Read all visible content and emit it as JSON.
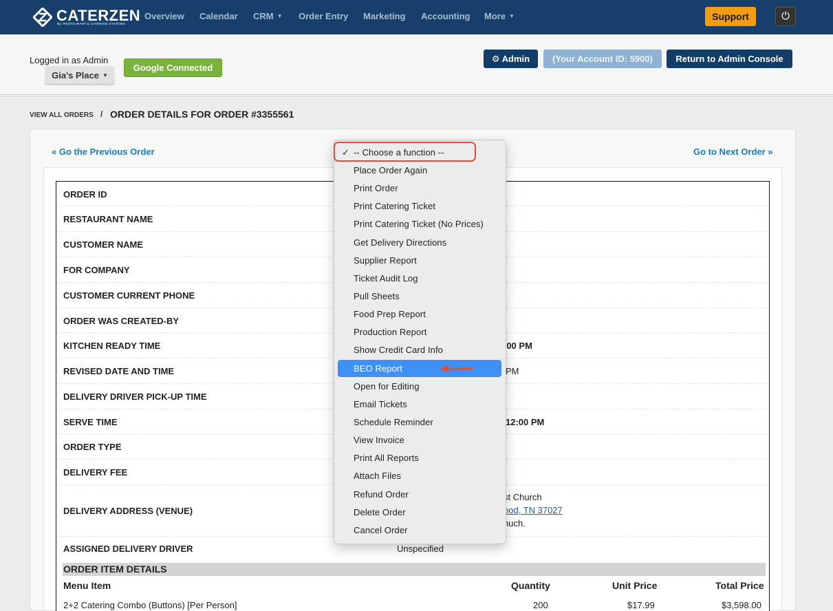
{
  "brand": {
    "name": "CATERZEN",
    "tagline": "By: RESTAURANT & CATERING SYSTEMS"
  },
  "nav": {
    "items": [
      {
        "label": "Overview"
      },
      {
        "label": "Calendar"
      },
      {
        "label": "CRM"
      },
      {
        "label": "Order Entry"
      },
      {
        "label": "Marketing"
      },
      {
        "label": "Accounting"
      },
      {
        "label": "More"
      }
    ],
    "support_label": "Support",
    "power_glyph": "⏻"
  },
  "header": {
    "logged_in_text": "Logged in as Admin",
    "place_label": "Gia's Place",
    "google_label": "Google Connected",
    "admin_label": "Admin",
    "account_label": "(Your Account ID: 5900)",
    "console_label": "Return to Admin Console"
  },
  "breadcrumb": {
    "link": "VIEW ALL ORDERS",
    "separator": "/",
    "title": "ORDER DETAILS FOR ORDER #3355561"
  },
  "pager": {
    "prev": "« Go the Previous Order",
    "next": "Go to Next Order »"
  },
  "details": {
    "rows": [
      {
        "label": "ORDER ID"
      },
      {
        "label": "RESTAURANT NAME"
      },
      {
        "label": "CUSTOMER NAME"
      },
      {
        "label": "FOR COMPANY"
      },
      {
        "label": "CUSTOMER CURRENT PHONE"
      },
      {
        "label": "ORDER WAS CREATED-BY"
      },
      {
        "label": "KITCHEN READY TIME",
        "value": ":00 PM"
      },
      {
        "label": "REVISED DATE AND TIME",
        "value": "PM"
      },
      {
        "label": "DELIVERY DRIVER PICK-UP TIME"
      },
      {
        "label": "SERVE TIME",
        "value": "12:00 PM"
      },
      {
        "label": "ORDER TYPE"
      },
      {
        "label": "DELIVERY FEE"
      },
      {
        "label": "DELIVERY ADDRESS (VENUE)",
        "value_line1": "st Church",
        "value_line2": "ood, TN 37027",
        "value_line3": "huch."
      },
      {
        "label": "ASSIGNED DELIVERY DRIVER",
        "value": "Unspecified"
      }
    ]
  },
  "items_section": {
    "title": "ORDER ITEM DETAILS",
    "columns": [
      "Menu Item",
      "Quantity",
      "Unit Price",
      "Total Price"
    ],
    "rows": [
      {
        "item": "2+2 Catering Combo (Buttons) [Per Person]",
        "quantity": "200",
        "unit_price": "$17.99",
        "total_price": "$3,598.00"
      }
    ]
  },
  "function_menu": {
    "selected_check": "✓",
    "items": [
      "-- Choose a function --",
      "Place Order Again",
      "Print Order",
      "Print Catering Ticket",
      "Print Catering Ticket (No Prices)",
      "Get Delivery Directions",
      "Supplier Report",
      "Ticket Audit Log",
      "Pull Sheets",
      "Food Prep Report",
      "Production Report",
      "Show Credit Card Info",
      "BEO Report",
      "Open for Editing",
      "Email Tickets",
      "Schedule Reminder",
      "View Invoice",
      "Print All Reports",
      "Attach Files",
      "Refund Order",
      "Delete Order",
      "Cancel Order"
    ],
    "highlighted_item": "BEO Report",
    "annotation_color": "#e14d3c"
  }
}
